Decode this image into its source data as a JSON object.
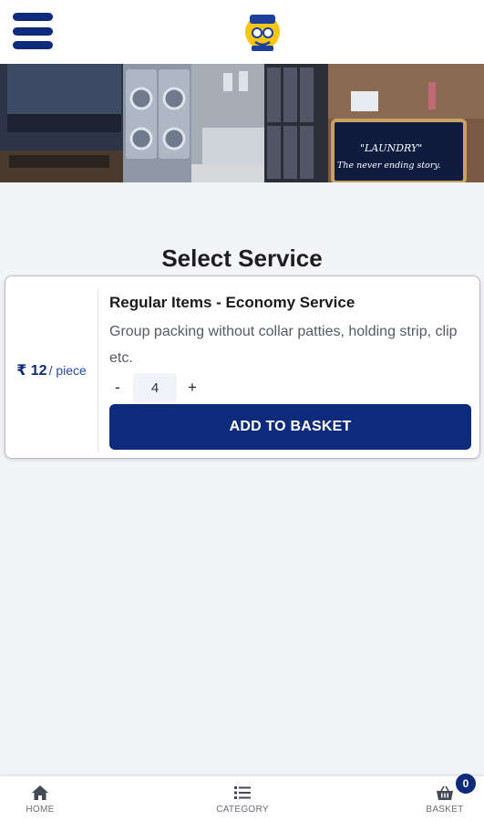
{
  "header": {
    "menu_icon": "hamburger-menu-icon",
    "logo_icon": "laundry-mascot-logo"
  },
  "banner": {
    "sign_line1": "\"LAUNDRY\"",
    "sign_line2": "The never ending story."
  },
  "page": {
    "title": "Select Service"
  },
  "service": {
    "price_amount": "₹ 12",
    "price_unit": "/ piece",
    "name": "Regular Items - Economy Service",
    "description": "Group packing without collar patties, holding strip, clip etc.",
    "qty_minus": "-",
    "quantity": "4",
    "qty_plus": "+",
    "add_button_label": "ADD TO BASKET"
  },
  "bottom_nav": {
    "home": {
      "label": "HOME",
      "icon": "home-icon"
    },
    "category": {
      "label": "CATEGORY",
      "icon": "list-icon"
    },
    "basket": {
      "label": "BASKET",
      "icon": "basket-icon",
      "badge_count": "0"
    }
  },
  "colors": {
    "primary": "#0d2b7a",
    "background": "#f3f4f7",
    "card": "#ffffff"
  }
}
